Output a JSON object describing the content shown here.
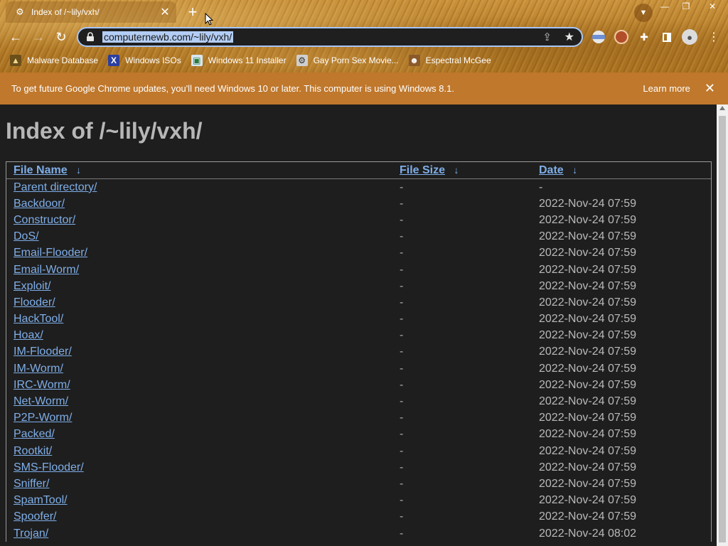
{
  "browser": {
    "tab_title": "Index of /~lily/vxh/",
    "url": "computernewb.com/~lily/vxh/",
    "bookmarks": [
      {
        "label": "Malware Database",
        "icon": "m"
      },
      {
        "label": "Windows ISOs",
        "icon": "x"
      },
      {
        "label": "Windows 11 Installer",
        "icon": "w"
      },
      {
        "label": "Gay Porn Sex Movie...",
        "icon": "g"
      },
      {
        "label": "Espectral McGee",
        "icon": "e"
      }
    ]
  },
  "banner": {
    "text": "To get future Google Chrome updates, you'll need Windows 10 or later. This computer is using Windows 8.1.",
    "learn_more": "Learn more"
  },
  "page": {
    "title": "Index of /~lily/vxh/",
    "columns": {
      "name": "File Name",
      "size": "File Size",
      "date": "Date",
      "arrow": "↓"
    },
    "rows": [
      {
        "name": "Parent directory/",
        "size": "-",
        "date": "-"
      },
      {
        "name": "Backdoor/",
        "size": "-",
        "date": "2022-Nov-24 07:59"
      },
      {
        "name": "Constructor/",
        "size": "-",
        "date": "2022-Nov-24 07:59"
      },
      {
        "name": "DoS/",
        "size": "-",
        "date": "2022-Nov-24 07:59"
      },
      {
        "name": "Email-Flooder/",
        "size": "-",
        "date": "2022-Nov-24 07:59"
      },
      {
        "name": "Email-Worm/",
        "size": "-",
        "date": "2022-Nov-24 07:59"
      },
      {
        "name": "Exploit/",
        "size": "-",
        "date": "2022-Nov-24 07:59"
      },
      {
        "name": "Flooder/",
        "size": "-",
        "date": "2022-Nov-24 07:59"
      },
      {
        "name": "HackTool/",
        "size": "-",
        "date": "2022-Nov-24 07:59"
      },
      {
        "name": "Hoax/",
        "size": "-",
        "date": "2022-Nov-24 07:59"
      },
      {
        "name": "IM-Flooder/",
        "size": "-",
        "date": "2022-Nov-24 07:59"
      },
      {
        "name": "IM-Worm/",
        "size": "-",
        "date": "2022-Nov-24 07:59"
      },
      {
        "name": "IRC-Worm/",
        "size": "-",
        "date": "2022-Nov-24 07:59"
      },
      {
        "name": "Net-Worm/",
        "size": "-",
        "date": "2022-Nov-24 07:59"
      },
      {
        "name": "P2P-Worm/",
        "size": "-",
        "date": "2022-Nov-24 07:59"
      },
      {
        "name": "Packed/",
        "size": "-",
        "date": "2022-Nov-24 07:59"
      },
      {
        "name": "Rootkit/",
        "size": "-",
        "date": "2022-Nov-24 07:59"
      },
      {
        "name": "SMS-Flooder/",
        "size": "-",
        "date": "2022-Nov-24 07:59"
      },
      {
        "name": "Sniffer/",
        "size": "-",
        "date": "2022-Nov-24 07:59"
      },
      {
        "name": "SpamTool/",
        "size": "-",
        "date": "2022-Nov-24 07:59"
      },
      {
        "name": "Spoofer/",
        "size": "-",
        "date": "2022-Nov-24 07:59"
      },
      {
        "name": "Trojan/",
        "size": "-",
        "date": "2022-Nov-24 08:02"
      }
    ]
  }
}
